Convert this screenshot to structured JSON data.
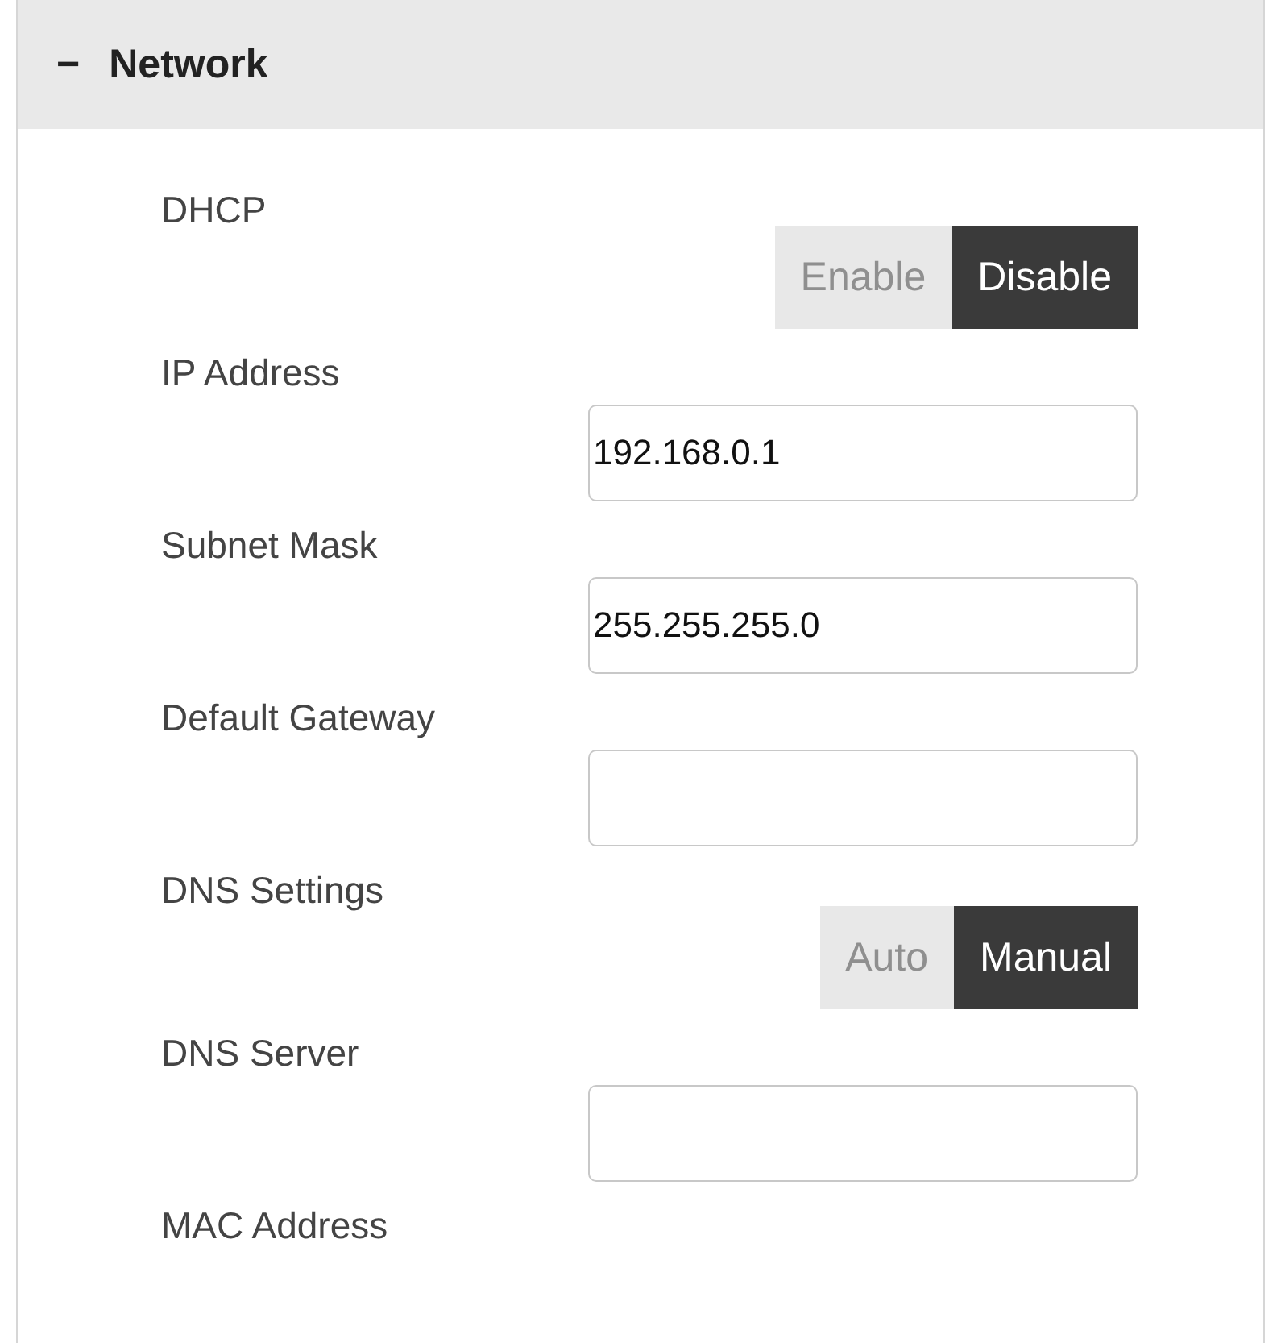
{
  "section": {
    "expander": "−",
    "title": "Network"
  },
  "fields": [
    {
      "kind": "toggle",
      "label": "DHCP",
      "options": [
        {
          "label": "Enable",
          "selected": false
        },
        {
          "label": "Disable",
          "selected": true
        }
      ]
    },
    {
      "kind": "input",
      "label": "IP Address",
      "value": "192.168.0.1"
    },
    {
      "kind": "input",
      "label": "Subnet Mask",
      "value": "255.255.255.0"
    },
    {
      "kind": "input",
      "label": "Default Gateway"
    },
    {
      "kind": "toggle",
      "label": "DNS Settings",
      "options": [
        {
          "label": "Auto",
          "selected": false
        },
        {
          "label": "Manual",
          "selected": true
        }
      ]
    },
    {
      "kind": "input",
      "label": "DNS Server"
    },
    {
      "kind": "label",
      "label": "MAC Address"
    }
  ]
}
